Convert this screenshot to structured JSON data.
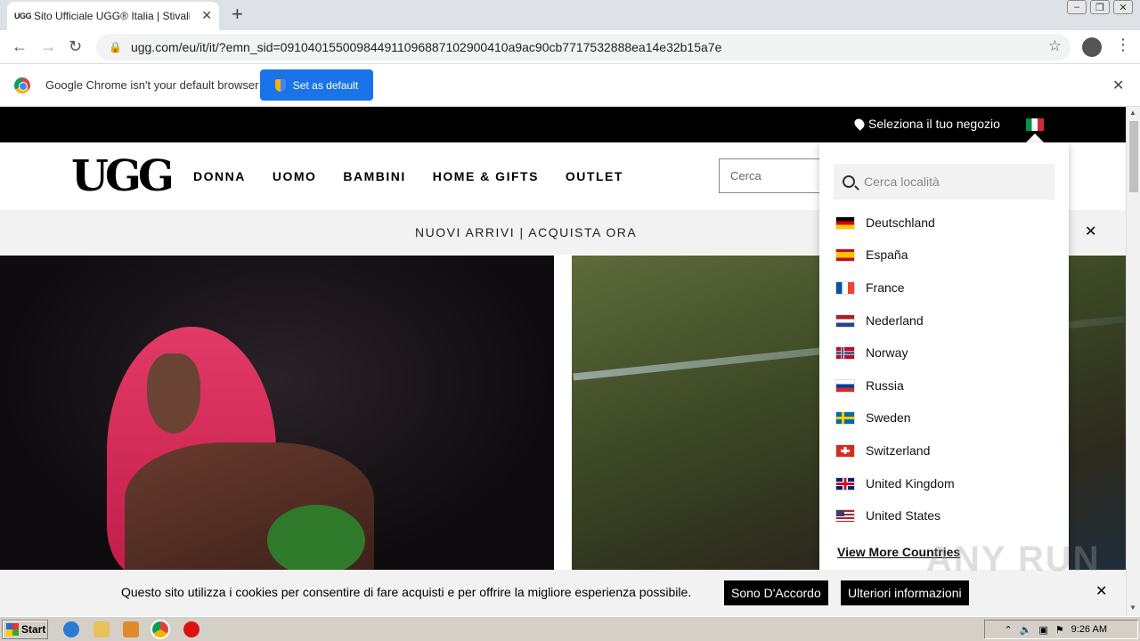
{
  "browser": {
    "tab_title": "Sito Ufficiale UGG® Italia | Stivali, P...",
    "tab_favicon": "UGG",
    "url": "ugg.com/eu/it/it/?emn_sid=091040155009844911096887102900410a9ac90cb7717532888ea14e32b15a7e"
  },
  "infobar": {
    "message": "Google Chrome isn't your default browser",
    "button": "Set as default"
  },
  "site": {
    "store_select": "Seleziona il tuo negozio",
    "logo": "UGG",
    "nav": [
      "DONNA",
      "UOMO",
      "BAMBINI",
      "HOME & GIFTS",
      "OUTLET"
    ],
    "search_placeholder": "Cerca",
    "promo": "NUOVI ARRIVI | ACQUISTA ORA"
  },
  "dropdown": {
    "search_placeholder": "Cerca località",
    "countries": [
      {
        "name": "Deutschland",
        "flag": "de"
      },
      {
        "name": "España",
        "flag": "es"
      },
      {
        "name": "France",
        "flag": "fr"
      },
      {
        "name": "Nederland",
        "flag": "nl"
      },
      {
        "name": "Norway",
        "flag": "no"
      },
      {
        "name": "Russia",
        "flag": "ru"
      },
      {
        "name": "Sweden",
        "flag": "se"
      },
      {
        "name": "Switzerland",
        "flag": "ch"
      },
      {
        "name": "United Kingdom",
        "flag": "gb"
      },
      {
        "name": "United States",
        "flag": "us"
      }
    ],
    "view_more": "View More Countries"
  },
  "cookie": {
    "message": "Questo sito utilizza i cookies per consentire di fare acquisti e per offrire la migliore esperienza possibile.",
    "agree": "Sono D'Accordo",
    "more_info": "Ulteriori informazioni"
  },
  "watermark": "ANY RUN",
  "taskbar": {
    "start": "Start",
    "clock": "9:26 AM"
  }
}
